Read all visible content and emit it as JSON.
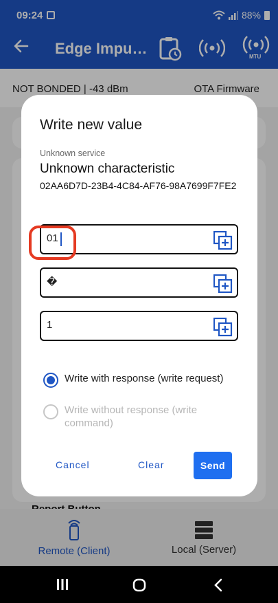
{
  "status_bar": {
    "time": "09:24",
    "battery": "88%"
  },
  "app_bar": {
    "title": "Edge Impu…",
    "icons": [
      "back-arrow-icon",
      "clipboard-clock-icon",
      "broadcast-icon",
      "mtu-icon"
    ],
    "mtu_label": "MTU"
  },
  "background": {
    "connection_status": "NOT BONDED | -43 dBm",
    "ota_label": "OTA Firmware",
    "report_label": "Report Button"
  },
  "bottom_nav": {
    "items": [
      {
        "label": "Remote (Client)",
        "icon": "remote-client-icon",
        "active": true
      },
      {
        "label": "Local (Server)",
        "icon": "server-icon",
        "active": false
      }
    ]
  },
  "dialog": {
    "title": "Write new value",
    "service": "Unknown service",
    "characteristic": "Unknown characteristic",
    "uuid": "02AA6D7D-23B4-4C84-AF76-98A7699F7FE2",
    "fields": [
      {
        "value": "01",
        "icon": "copy-add-icon"
      },
      {
        "value": "�",
        "icon": "copy-add-icon"
      },
      {
        "value": "1",
        "icon": "copy-add-icon"
      }
    ],
    "radio_options": [
      {
        "label": "Write with response (write request)",
        "selected": true,
        "enabled": true
      },
      {
        "label": "Write without response (write command)",
        "selected": false,
        "enabled": false
      }
    ],
    "buttons": {
      "cancel": "Cancel",
      "clear": "Clear",
      "send": "Send"
    }
  },
  "colors": {
    "primary": "#1f56c4",
    "highlight": "#e53a22",
    "send_button": "#1f6ff0"
  }
}
